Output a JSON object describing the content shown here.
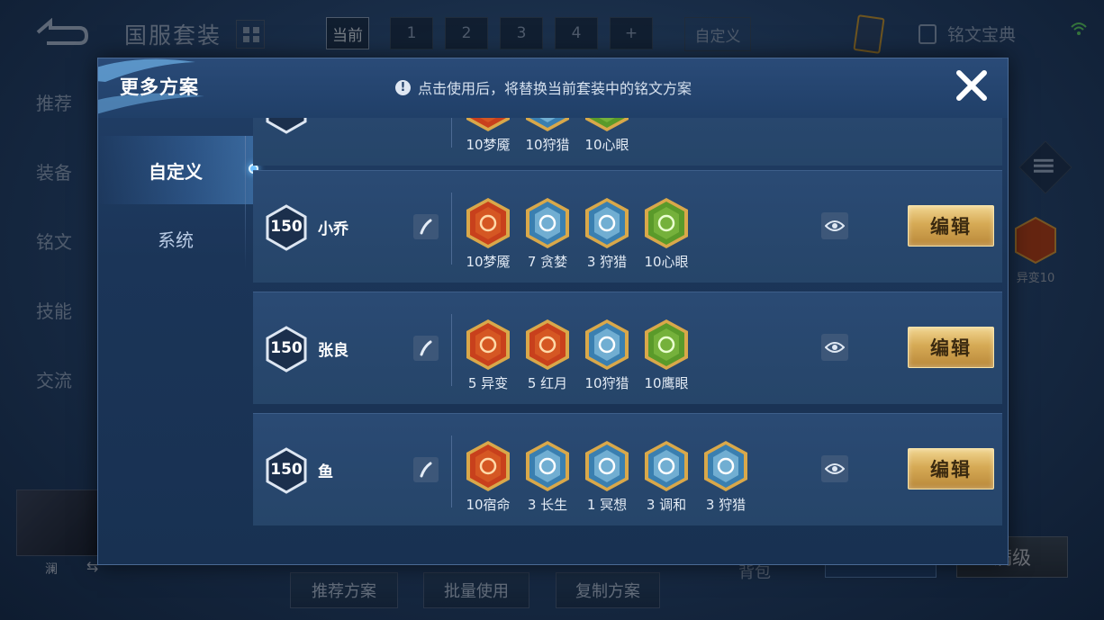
{
  "background": {
    "title": "国服套装",
    "page_tabs": [
      "当前",
      "1",
      "2",
      "3",
      "4",
      "+"
    ],
    "custom_tab": "自定义",
    "dex_label": "铭文宝典",
    "side_nav": [
      "推荐",
      "装备",
      "铭文",
      "技能",
      "交流"
    ],
    "side_rune_label": "异变10",
    "hero_name": "澜",
    "bottom_buttons": [
      "推荐方案",
      "批量使用",
      "复制方案"
    ],
    "bag_label": "背包",
    "fill_label": "满级"
  },
  "modal": {
    "title": "更多方案",
    "notice": "点击使用后，将替换当前套装中的铭文方案",
    "tabs": [
      "自定义",
      "系统"
    ],
    "edit_label": "编辑",
    "rows": [
      {
        "level": "",
        "name": "",
        "runes": [
          {
            "label": "10梦魇",
            "icon": "mengyan-rune-icon",
            "color": "red"
          },
          {
            "label": "10狩猎",
            "icon": "shoulie-rune-icon",
            "color": "blue"
          },
          {
            "label": "10心眼",
            "icon": "xinyan-rune-icon",
            "color": "green"
          }
        ]
      },
      {
        "level": "150",
        "name": "小乔",
        "runes": [
          {
            "label": "10梦魇",
            "icon": "mengyan-rune-icon",
            "color": "red"
          },
          {
            "label": "7 贪婪",
            "icon": "tanlan-rune-icon",
            "color": "blue"
          },
          {
            "label": "3 狩猎",
            "icon": "shoulie-rune-icon",
            "color": "blue"
          },
          {
            "label": "10心眼",
            "icon": "xinyan-rune-icon",
            "color": "green"
          }
        ]
      },
      {
        "level": "150",
        "name": "张良",
        "runes": [
          {
            "label": "5 异变",
            "icon": "yibian-rune-icon",
            "color": "red"
          },
          {
            "label": "5 红月",
            "icon": "hongyue-rune-icon",
            "color": "red"
          },
          {
            "label": "10狩猎",
            "icon": "shoulie-rune-icon",
            "color": "blue"
          },
          {
            "label": "10鹰眼",
            "icon": "yingyan-rune-icon",
            "color": "green"
          }
        ]
      },
      {
        "level": "150",
        "name": "鱼",
        "runes": [
          {
            "label": "10宿命",
            "icon": "suming-rune-icon",
            "color": "red"
          },
          {
            "label": "3 长生",
            "icon": "changsheng-rune-icon",
            "color": "blue"
          },
          {
            "label": "1 冥想",
            "icon": "mingxiang-rune-icon",
            "color": "blue"
          },
          {
            "label": "3 调和",
            "icon": "tiaohe-rune-icon",
            "color": "blue"
          },
          {
            "label": "3 狩猎",
            "icon": "shoulie-rune-icon",
            "color": "blue"
          }
        ]
      }
    ]
  },
  "colors": {
    "accent_gold": "#d6aa55",
    "modal_bg": "#1b3558",
    "rune_red": "#c8401c",
    "rune_blue": "#3a7fb0",
    "rune_green": "#5a9a2a"
  }
}
